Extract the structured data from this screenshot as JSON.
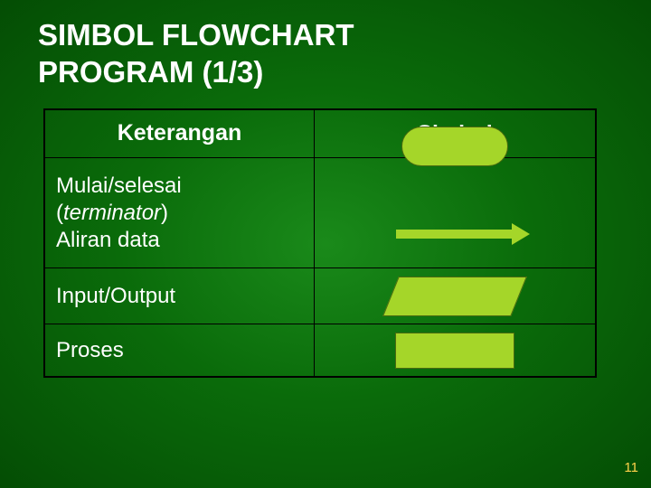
{
  "title_line1": "SIMBOL FLOWCHART",
  "title_line2": "PROGRAM (1/3)",
  "header": {
    "desc": "Keterangan",
    "sym": "Simbol"
  },
  "rows": {
    "terminator": {
      "line1": "Mulai/selesai",
      "line2_open": "(",
      "line2_word": "terminator",
      "line2_close": ")",
      "line3": "Aliran data"
    },
    "io": "Input/Output",
    "proses": "Proses"
  },
  "pagenum": "11"
}
